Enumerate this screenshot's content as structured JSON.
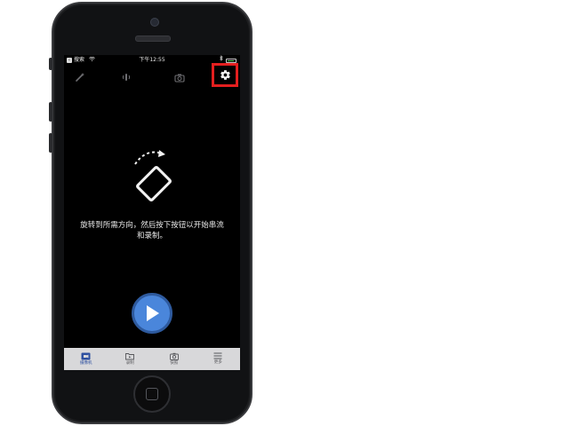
{
  "status_bar": {
    "back_app": "搜索",
    "time": "下午12:55"
  },
  "main": {
    "instruction_line1": "旋转到所需方向，然后按下按钮以开始串流",
    "instruction_line2": "和录制。"
  },
  "tabs": [
    {
      "label": "摄像机",
      "icon": "camera-video-icon",
      "active": true
    },
    {
      "label": "录制",
      "icon": "folder-icon",
      "active": false
    },
    {
      "label": "快照",
      "icon": "photo-camera-icon",
      "active": false
    },
    {
      "label": "更多",
      "icon": "menu-icon",
      "active": false
    }
  ],
  "colors": {
    "accent": "#4a86db",
    "highlight": "#e31f1f",
    "active_tab": "#2d4fa0"
  }
}
